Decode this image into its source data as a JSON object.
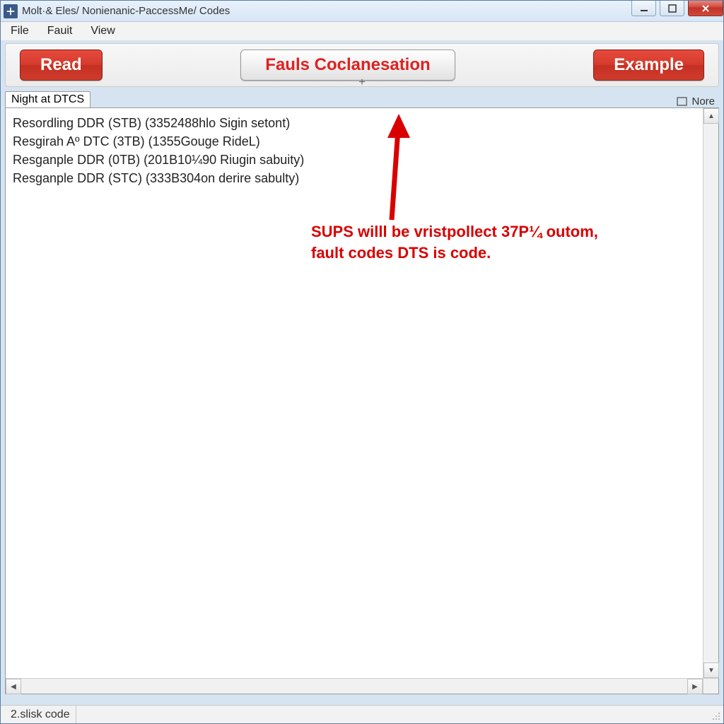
{
  "window": {
    "title": "Molt·& Eles/ Nonienanic-PaccessMe/ Codes"
  },
  "menu": {
    "file": "File",
    "fault": "Fauit",
    "view": "View"
  },
  "toolbar": {
    "read": "Read",
    "fauls": "Fauls Coclanesation",
    "example": "Example",
    "plus": "+"
  },
  "tabs": {
    "left": "Night at DTCS",
    "right_label": "Nore"
  },
  "rows": [
    "Resordling DDR (STB) (3352488hlo Sigin setont)",
    "Resgirah Aº DTC (3TB) (1355Gouge RideL)",
    "Resganple DDR (0TB) (201B10¼90 Riugin sabuity)",
    "Resganple DDR (STC) (333B304on derire sabulty)"
  ],
  "annotation": {
    "line1": "SUPS willl be vristpollect 37P¼ outom,",
    "line2": "fault codes DTS is code."
  },
  "status": {
    "cell1": "2.slisk code"
  }
}
